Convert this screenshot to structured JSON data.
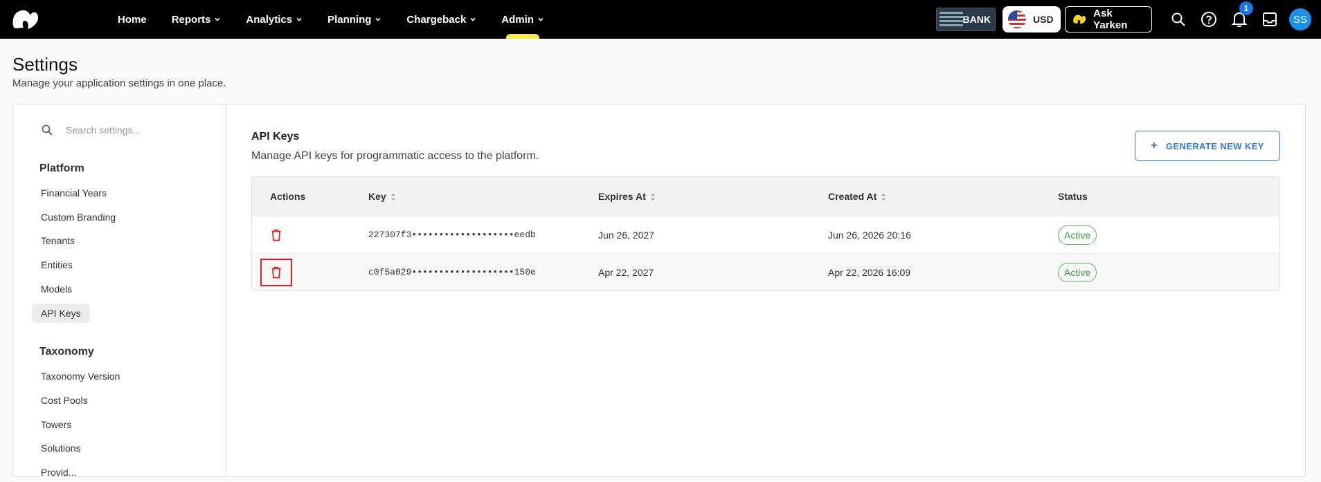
{
  "nav": {
    "items": [
      {
        "label": "Home",
        "dropdown": false
      },
      {
        "label": "Reports",
        "dropdown": true
      },
      {
        "label": "Analytics",
        "dropdown": true
      },
      {
        "label": "Planning",
        "dropdown": true
      },
      {
        "label": "Chargeback",
        "dropdown": true
      },
      {
        "label": "Admin",
        "dropdown": true,
        "active": true
      }
    ],
    "bank_label": "BANK",
    "currency": "USD",
    "ask_label": "Ask Yarken",
    "notification_count": "1",
    "avatar_initials": "SS"
  },
  "page": {
    "title": "Settings",
    "subtitle": "Manage your application settings in one place."
  },
  "sidebar": {
    "search_placeholder": "Search settings...",
    "sections": [
      {
        "title": "Platform",
        "items": [
          "Financial Years",
          "Custom Branding",
          "Tenants",
          "Entities",
          "Models",
          "API Keys"
        ]
      },
      {
        "title": "Taxonomy",
        "items": [
          "Taxonomy Version",
          "Cost Pools",
          "Towers",
          "Solutions",
          "Provid..."
        ]
      }
    ],
    "active_item": "API Keys"
  },
  "content": {
    "title": "API Keys",
    "subtitle": "Manage API keys for programmatic access to the platform.",
    "generate_button": "GENERATE NEW KEY",
    "table": {
      "headers": [
        "Actions",
        "Key",
        "Expires At",
        "Created At",
        "Status"
      ],
      "rows": [
        {
          "key": "227307f3•••••••••••••••••••eedb",
          "expires": "Jun 26, 2027",
          "created": "Jun 26, 2026 20:16",
          "status": "Active"
        },
        {
          "key": "c0f5a029•••••••••••••••••••150e",
          "expires": "Apr 22, 2027",
          "created": "Apr 22, 2026 16:09",
          "status": "Active"
        }
      ]
    }
  },
  "colors": {
    "accent": "#2d7bd6",
    "active_tab": "#ffe84d",
    "danger": "#e02020",
    "success": "#3a9a3a"
  }
}
